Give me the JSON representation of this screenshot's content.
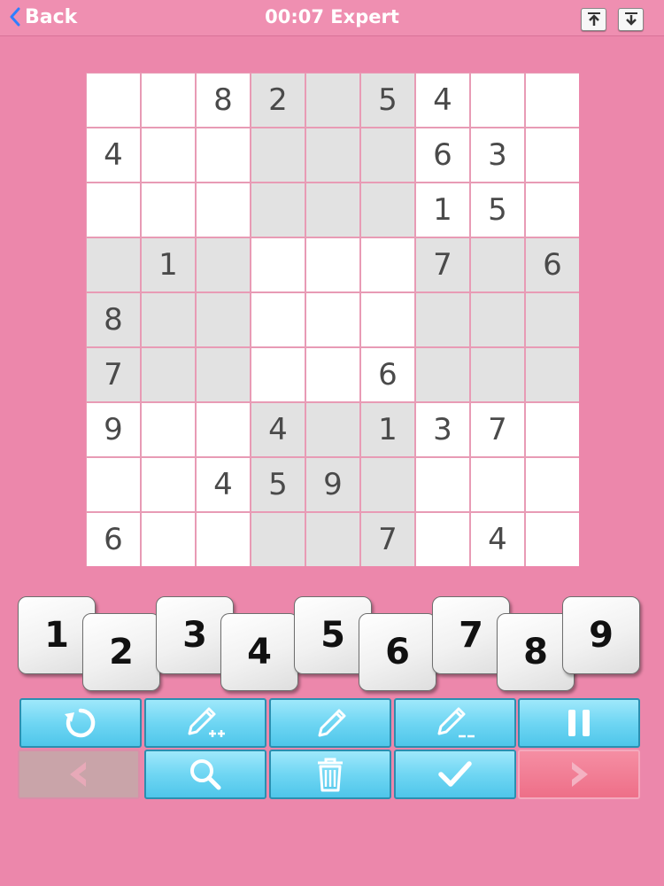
{
  "header": {
    "back_label": "Back",
    "title": "00:07 Expert"
  },
  "board": {
    "rows": [
      [
        "",
        "",
        "8",
        "2",
        "",
        "5",
        "4",
        "",
        ""
      ],
      [
        "4",
        "",
        "",
        "",
        "",
        "",
        "6",
        "3",
        ""
      ],
      [
        "",
        "",
        "",
        "",
        "",
        "",
        "1",
        "5",
        ""
      ],
      [
        "",
        "1",
        "",
        "",
        "",
        "",
        "7",
        "",
        "6"
      ],
      [
        "8",
        "",
        "",
        "",
        "",
        "",
        "",
        "",
        ""
      ],
      [
        "7",
        "",
        "",
        "",
        "",
        "6",
        "",
        "",
        ""
      ],
      [
        "9",
        "",
        "",
        "4",
        "",
        "1",
        "3",
        "7",
        ""
      ],
      [
        "",
        "",
        "4",
        "5",
        "9",
        "",
        "",
        "",
        ""
      ],
      [
        "6",
        "",
        "",
        "",
        "",
        "7",
        "",
        "4",
        ""
      ]
    ]
  },
  "number_pad": [
    "1",
    "2",
    "3",
    "4",
    "5",
    "6",
    "7",
    "8",
    "9"
  ],
  "controls": [
    {
      "name": "reset-button",
      "icon": "reset-icon"
    },
    {
      "name": "add-all-notes-button",
      "icon": "pencil-plus-icon"
    },
    {
      "name": "pencil-button",
      "icon": "pencil-icon"
    },
    {
      "name": "clear-notes-button",
      "icon": "pencil-minus-icon"
    },
    {
      "name": "pause-button",
      "icon": "pause-icon"
    },
    {
      "name": "previous-button",
      "icon": "chevron-left-icon"
    },
    {
      "name": "hint-button",
      "icon": "magnifier-icon"
    },
    {
      "name": "delete-button",
      "icon": "trash-icon"
    },
    {
      "name": "check-button",
      "icon": "checkmark-icon"
    },
    {
      "name": "next-button",
      "icon": "chevron-right-icon"
    }
  ],
  "colors": {
    "background": "#ec87ab",
    "light_box": "#ffffff",
    "dark_box": "#e2e2e2",
    "control_blue": "#6fd6f3",
    "next_red": "#ee6f88"
  }
}
